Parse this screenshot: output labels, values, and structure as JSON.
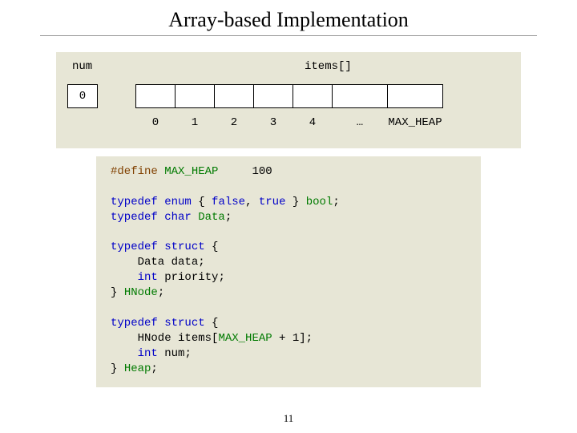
{
  "title": "Array-based Implementation",
  "diagram": {
    "num_label": "num",
    "items_label": "items[]",
    "num_value": "0",
    "indices": [
      "0",
      "1",
      "2",
      "3",
      "4",
      "…",
      "MAX_HEAP"
    ]
  },
  "code": {
    "define": {
      "kw": "#define",
      "name": "MAX_HEAP",
      "val": "100"
    },
    "bool_line": {
      "typedef": "typedef",
      "enum": "enum",
      "open": " { ",
      "f": "false",
      "sep": ", ",
      "t": "true",
      "close": " } ",
      "type": "bool",
      "semi": ";"
    },
    "data_line": {
      "typedef": "typedef",
      "char": "char",
      "type": " Data",
      "semi": ";"
    },
    "hnode": {
      "typedef": "typedef",
      "struct": "struct",
      "open": " {",
      "l1a": "    Data ",
      "l1b": "data",
      "l1c": ";",
      "l2a": "    ",
      "l2b": "int",
      "l2c": " priority",
      "l2d": ";",
      "close": "} ",
      "type": "HNode",
      "semi": ";"
    },
    "heap": {
      "typedef": "typedef",
      "struct": "struct",
      "open": " {",
      "l1a": "    HNode ",
      "l1b": "items",
      "l1c": "[",
      "l1d": "MAX_HEAP",
      "l1e": " + 1];",
      "l2a": "    ",
      "l2b": "int",
      "l2c": " num",
      "l2d": ";",
      "close": "} ",
      "type": "Heap",
      "semi": ";"
    }
  },
  "page_number": "11"
}
